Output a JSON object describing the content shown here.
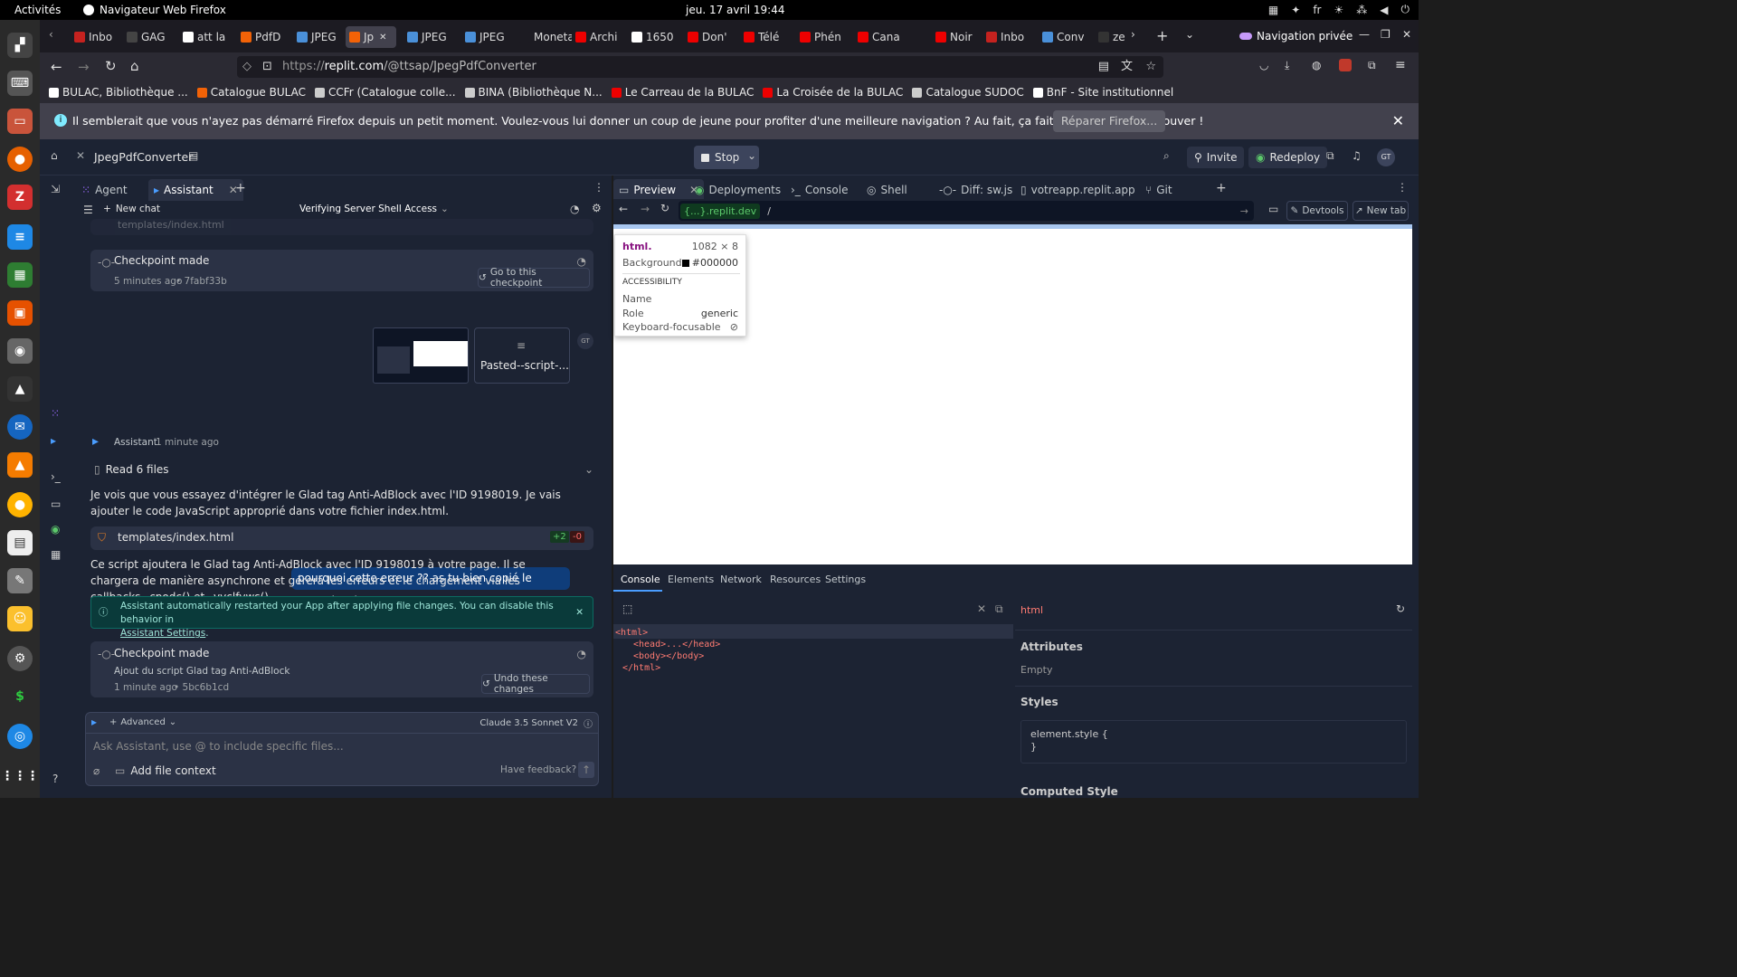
{
  "topbar": {
    "activities": "Activités",
    "app": "Navigateur Web Firefox",
    "clock": "jeu. 17 avril  19:44",
    "lang": "fr"
  },
  "tabs": [
    {
      "label": "Inbo",
      "color": "#c5221f"
    },
    {
      "label": "GAG",
      "color": "#444"
    },
    {
      "label": "att la",
      "color": "#fff"
    },
    {
      "label": "PdfD",
      "color": "#f26207"
    },
    {
      "label": "JPEG",
      "color": "#4a90d9"
    },
    {
      "label": "Jp",
      "color": "#f26207"
    },
    {
      "label": "JPEG",
      "color": "#4a90d9"
    },
    {
      "label": "JPEG",
      "color": "#4a90d9"
    },
    {
      "label": "Moneta",
      "color": "#1c1b22"
    },
    {
      "label": "Archi",
      "color": "#e00"
    },
    {
      "label": "1650",
      "color": "#fff"
    },
    {
      "label": "Don'",
      "color": "#e00"
    },
    {
      "label": "Télé",
      "color": "#e00"
    },
    {
      "label": "Phén",
      "color": "#e00"
    },
    {
      "label": "Cana",
      "color": "#e00"
    },
    {
      "label": "Noir",
      "color": "#e00"
    },
    {
      "label": "Inbo",
      "color": "#c5221f"
    },
    {
      "label": "Conv",
      "color": "#4a90d9"
    },
    {
      "label": "ze",
      "color": "#333"
    }
  ],
  "private": "Navigation privée",
  "url": {
    "prefix": "https://",
    "host": "replit.com",
    "path": "/@ttsap/JpegPdfConverter"
  },
  "bookmarks": [
    {
      "label": "BULAC, Bibliothèque ...",
      "color": "#fff"
    },
    {
      "label": "Catalogue BULAC",
      "color": "#f26207"
    },
    {
      "label": "CCFr (Catalogue colle...",
      "color": "#ccc"
    },
    {
      "label": "BINA (Bibliothèque N...",
      "color": "#ccc"
    },
    {
      "label": "Le Carreau de la BULAC",
      "color": "#e00"
    },
    {
      "label": "La Croisée de la BULAC",
      "color": "#e00"
    },
    {
      "label": "Catalogue SUDOC",
      "color": "#ccc"
    },
    {
      "label": "BnF - Site institutionnel",
      "color": "#fff"
    }
  ],
  "notice": {
    "text": "Il semblerait que vous n'ayez pas démarré Firefox depuis un petit moment. Voulez-vous lui donner un coup de jeune pour profiter d'une meilleure navigation ? Au fait, ça fait plaisir de vous retrouver !",
    "button": "Réparer Firefox..."
  },
  "replit": {
    "project": "JpegPdfConverter",
    "stop": "Stop",
    "invite": "Invite",
    "redeploy": "Redeploy",
    "avatar": "GT",
    "left_tabs": [
      "Agent",
      "Assistant"
    ],
    "new_chat": "New chat",
    "chat_title": "Verifying Server Shell Access",
    "file_top": "templates/index.html",
    "checkpoint1": {
      "title": "Checkpoint made",
      "time": "5 minutes ago",
      "hash": "• 7fabf33b",
      "btn": "Go to this checkpoint"
    },
    "attachment": "Pasted--script-...",
    "user_msg": "pourquoi cette erreur ?? as tu bien copié le pasted script ?",
    "assistant_name": "Assistant",
    "assistant_time": "1 minute ago",
    "read_files": "Read 6 files",
    "msg1": "Je vois que vous essayez d'intégrer le Glad tag Anti-AdBlock avec l'ID 9198019. Je vais ajouter le code JavaScript approprié dans votre fichier index.html.",
    "file": "templates/index.html",
    "plus": "+2",
    "minus": "-0",
    "msg2": "Ce script ajoutera le Glad tag Anti-AdBlock avec l'ID 9198019 à votre page. Il se chargera de manière asynchrone et gérera les erreurs et le chargement via les callbacks _cpodc() et _vyclfvws().",
    "info": "Assistant automatically restarted your App after applying file changes. You can disable this behavior in",
    "info_link": "Assistant Settings",
    "checkpoint2": {
      "title": "Checkpoint made",
      "desc": "Ajout du script Glad tag Anti-AdBlock",
      "time": "1 minute ago",
      "hash": "• 5bc6b1cd",
      "btn": "Undo these changes"
    },
    "advanced": "Advanced",
    "model": "Claude 3.5 Sonnet V2",
    "placeholder": "Ask Assistant, use @ to include specific files...",
    "add_context": "Add file context",
    "feedback": "Have feedback?",
    "right_tabs": [
      "Preview",
      "Deployments",
      "Console",
      "Shell",
      "Diff: sw.js",
      "votreapp.replit.app",
      "Git"
    ],
    "preview_host": "{...}.replit.dev",
    "preview_path": "/",
    "devtools": "Devtools",
    "newtab": "New tab",
    "tooltip": {
      "tag": "html.",
      "size": "1082 × 8",
      "bg_label": "Background",
      "bg": "#000000",
      "section": "ACCESSIBILITY",
      "name": "Name",
      "role": "Role",
      "role_val": "generic",
      "kf": "Keyboard-focusable"
    },
    "dev_tabs": [
      "Console",
      "Elements",
      "Network",
      "Resources",
      "Settings"
    ],
    "dom": [
      "<html>",
      "<head>...</head>",
      "<body></body>",
      "</html>"
    ],
    "inspector": {
      "el": "html",
      "attr": "Attributes",
      "empty": "Empty",
      "styles": "Styles",
      "rule": "element.style {",
      "close": "}",
      "computed": "Computed Style"
    }
  }
}
